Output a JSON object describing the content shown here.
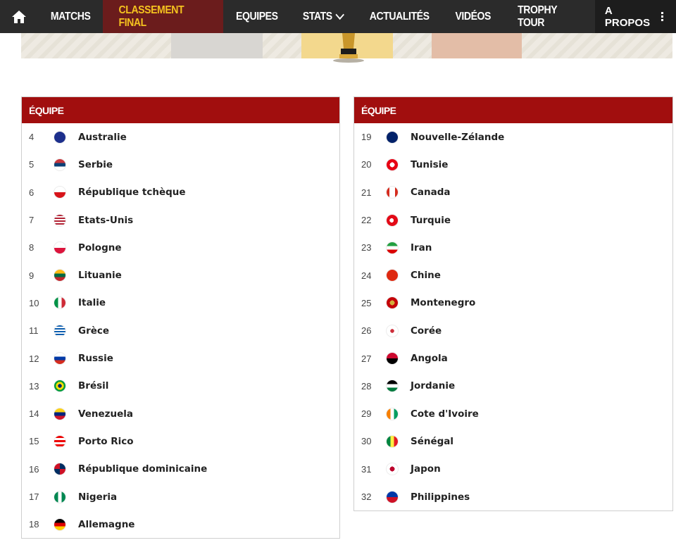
{
  "nav": {
    "items": [
      {
        "label": "Matchs"
      },
      {
        "label": "Classement final",
        "active": true
      },
      {
        "label": "Equipes"
      },
      {
        "label": "Stats"
      },
      {
        "label": "Actualités"
      },
      {
        "label": "Vidéos"
      },
      {
        "label": "Trophy Tour"
      }
    ],
    "about_label": "A propos"
  },
  "table_header": "ÉQUIPE",
  "left": [
    {
      "rank": "4",
      "team": "Australie",
      "flag": "linear-gradient(#1c2f8c,#1c2f8c)"
    },
    {
      "rank": "5",
      "team": "Serbie",
      "flag": "linear-gradient(#c6363c 0 33%,#0c4076 33% 66%,#fff 66%)"
    },
    {
      "rank": "6",
      "team": "République tchèque",
      "flag": "linear-gradient(#fff 0 50%,#d7141a 50%)"
    },
    {
      "rank": "7",
      "team": "Etats-Unis",
      "flag": "repeating-linear-gradient(#b22234 0 2px,#fff 2px 4px)"
    },
    {
      "rank": "8",
      "team": "Pologne",
      "flag": "linear-gradient(#fff 0 50%,#dc143c 50%)"
    },
    {
      "rank": "9",
      "team": "Lituanie",
      "flag": "linear-gradient(#fdb913 0 33%,#006a44 33% 66%,#c1272d 66%)"
    },
    {
      "rank": "10",
      "team": "Italie",
      "flag": "linear-gradient(90deg,#009246 0 33%,#fff 33% 66%,#ce2b37 66%)"
    },
    {
      "rank": "11",
      "team": "Grèce",
      "flag": "repeating-linear-gradient(#0d5eaf 0 2px,#fff 2px 4px)"
    },
    {
      "rank": "12",
      "team": "Russie",
      "flag": "linear-gradient(#fff 0 33%,#0039a6 33% 66%,#d52b1e 66%)"
    },
    {
      "rank": "13",
      "team": "Brésil",
      "flag": "radial-gradient(circle,#002776 0 25%,#fedf00 25% 50%,#009c3b 50%)"
    },
    {
      "rank": "14",
      "team": "Venezuela",
      "flag": "linear-gradient(#fcd116 0 33%,#00247d 33% 66%,#cf142b 66%)"
    },
    {
      "rank": "15",
      "team": "Porto Rico",
      "flag": "repeating-linear-gradient(#ed0000 0 3px,#fff 3px 6px)"
    },
    {
      "rank": "16",
      "team": "République dominicaine",
      "flag": "conic-gradient(#002d62 0 25%,#ce1126 25% 50%,#002d62 50% 75%,#ce1126 75%)"
    },
    {
      "rank": "17",
      "team": "Nigeria",
      "flag": "linear-gradient(90deg,#008751 0 33%,#fff 33% 66%,#008751 66%)"
    },
    {
      "rank": "18",
      "team": "Allemagne",
      "flag": "linear-gradient(#000 0 33%,#dd0000 33% 66%,#ffce00 66%)"
    }
  ],
  "right": [
    {
      "rank": "19",
      "team": "Nouvelle-Zélande",
      "flag": "linear-gradient(#012169,#012169)"
    },
    {
      "rank": "20",
      "team": "Tunisie",
      "flag": "radial-gradient(circle,#fff 0 30%,#e70013 30%)"
    },
    {
      "rank": "21",
      "team": "Canada",
      "flag": "linear-gradient(90deg,#d52b1e 0 25%,#fff 25% 75%,#d52b1e 75%)"
    },
    {
      "rank": "22",
      "team": "Turquie",
      "flag": "radial-gradient(circle at 45% 50%,#fff 0 25%,#e30a17 25%)"
    },
    {
      "rank": "23",
      "team": "Iran",
      "flag": "linear-gradient(#239f40 0 33%,#fff 33% 66%,#da0000 66%)"
    },
    {
      "rank": "24",
      "team": "Chine",
      "flag": "linear-gradient(#de2910,#de2910)"
    },
    {
      "rank": "25",
      "team": "Montenegro",
      "flag": "radial-gradient(circle,#d3ae3b 0 30%,#c40308 30%)"
    },
    {
      "rank": "26",
      "team": "Corée",
      "flag": "radial-gradient(circle,#cd2e3a 0 25%,#fff 25%)"
    },
    {
      "rank": "27",
      "team": "Angola",
      "flag": "linear-gradient(#cc092f 0 50%,#000 50%)"
    },
    {
      "rank": "28",
      "team": "Jordanie",
      "flag": "linear-gradient(#000 0 33%,#fff 33% 66%,#007a3d 66%)"
    },
    {
      "rank": "29",
      "team": "Cote d'Ivoire",
      "flag": "linear-gradient(90deg,#f77f00 0 33%,#fff 33% 66%,#009e60 66%)"
    },
    {
      "rank": "30",
      "team": "Sénégal",
      "flag": "linear-gradient(90deg,#00853f 0 33%,#fdef42 33% 66%,#e31b23 66%)"
    },
    {
      "rank": "31",
      "team": "Japon",
      "flag": "radial-gradient(circle,#bc002d 0 30%,#fff 30%)"
    },
    {
      "rank": "32",
      "team": "Philippines",
      "flag": "linear-gradient(#0038a8 0 50%,#ce1126 50%)"
    }
  ]
}
